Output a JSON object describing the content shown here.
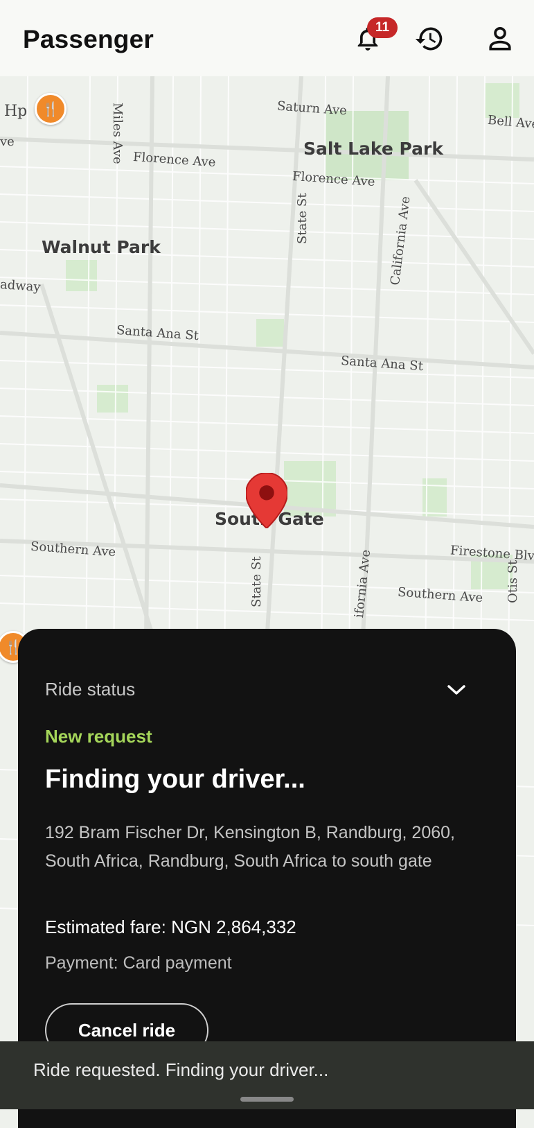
{
  "header": {
    "title": "Passenger",
    "notification_count": "11",
    "icons": [
      "bell-icon",
      "history-icon",
      "profile-icon"
    ]
  },
  "map": {
    "areas": [
      "Salt Lake Park",
      "Walnut Park",
      "South Gate"
    ],
    "streets": [
      "Saturn Ave",
      "Bell Ave",
      "Miles Ave",
      "Florence Ave",
      "Florence Ave",
      "State St",
      "California Ave",
      "adway",
      "Santa Ana St",
      "Santa Ana St",
      "Southern Ave",
      "State St",
      "Firestone Blvd",
      "Southern Ave",
      "Otis St",
      "ifornia Ave",
      "Hp",
      "ve"
    ],
    "pin_color": "#e53935",
    "poi_color": "#f08a2a"
  },
  "sheet": {
    "title": "Ride status",
    "status": "New request",
    "headline": "Finding your driver...",
    "route": "192 Bram Fischer Dr, Kensington B, Randburg, 2060, South Africa, Randburg, South Africa to south gate",
    "fare": "Estimated fare: NGN 2,864,332",
    "payment": "Payment: Card payment",
    "cancel_label": "Cancel ride"
  },
  "snackbar": {
    "message": "Ride requested. Finding your driver..."
  },
  "colors": {
    "accent_green": "#a5d65a",
    "badge_red": "#c62828",
    "sheet_bg": "#121212"
  }
}
